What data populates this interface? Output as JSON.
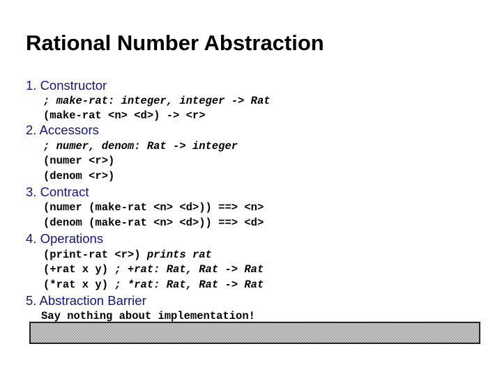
{
  "title": "Rational Number Abstraction",
  "sections": [
    {
      "heading": "1. Constructor",
      "lines": [
        {
          "code": "",
          "comment": "; make-rat: integer, integer -> Rat"
        },
        {
          "code": "(make-rat <n> <d>) -> <r>",
          "comment": ""
        }
      ]
    },
    {
      "heading": "2. Accessors",
      "lines": [
        {
          "code": "",
          "comment": "; numer, denom: Rat -> integer"
        },
        {
          "code": "(numer <r>)",
          "comment": ""
        },
        {
          "code": "(denom <r>)",
          "comment": ""
        }
      ]
    },
    {
      "heading": "3. Contract",
      "lines": [
        {
          "code": "(numer (make-rat <n> <d>)) ==> <n>",
          "comment": ""
        },
        {
          "code": "(denom (make-rat <n> <d>)) ==> <d>",
          "comment": ""
        }
      ]
    },
    {
      "heading": "4. Operations",
      "lines": [
        {
          "code": "(print-rat <r>) ",
          "comment": "prints rat"
        },
        {
          "code": "(+rat x y) ",
          "comment": "; +rat: Rat, Rat -> Rat"
        },
        {
          "code": "(*rat x y) ",
          "comment": "; *rat: Rat, Rat -> Rat"
        }
      ]
    },
    {
      "heading": "5. Abstraction Barrier",
      "lines": [
        {
          "code": "Say nothing about implementation!",
          "comment": ""
        }
      ]
    }
  ],
  "colors": {
    "heading": "#14148c",
    "text": "#000000",
    "barrier_fill": "#c8c8c8",
    "barrier_border": "#222222"
  }
}
